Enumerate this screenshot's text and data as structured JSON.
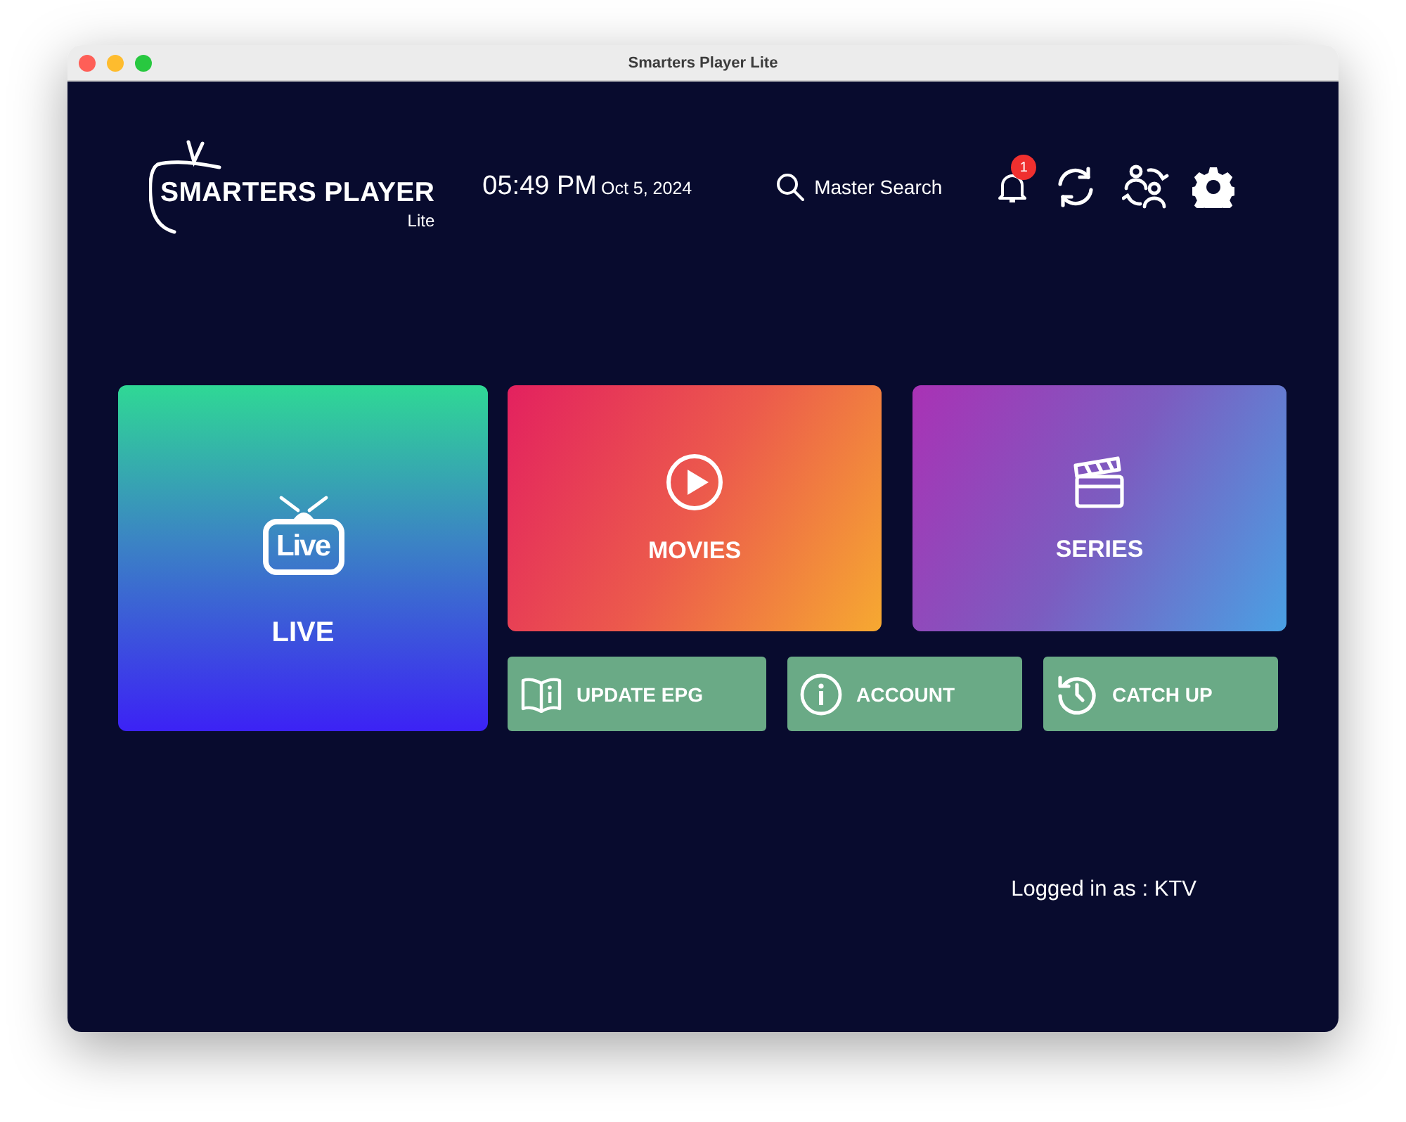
{
  "window": {
    "title": "Smarters Player Lite"
  },
  "header": {
    "logo": {
      "title": "SMARTERS PLAYER",
      "subtitle": "Lite"
    },
    "clock": {
      "time": "05:49 PM",
      "date": "Oct 5, 2024"
    },
    "search": {
      "label": "Master Search"
    },
    "notifications": {
      "badge": "1"
    }
  },
  "tiles": [
    {
      "kind": "live",
      "label": "LIVE",
      "icon_text": "Live"
    },
    {
      "kind": "movies",
      "label": "MOVIES"
    },
    {
      "kind": "series",
      "label": "SERIES"
    }
  ],
  "buttons": [
    {
      "kind": "epg",
      "label": "UPDATE EPG"
    },
    {
      "kind": "account",
      "label": "ACCOUNT"
    },
    {
      "kind": "catchup",
      "label": "CATCH UP"
    }
  ],
  "footer": {
    "logged_in": "Logged in as : KTV"
  }
}
